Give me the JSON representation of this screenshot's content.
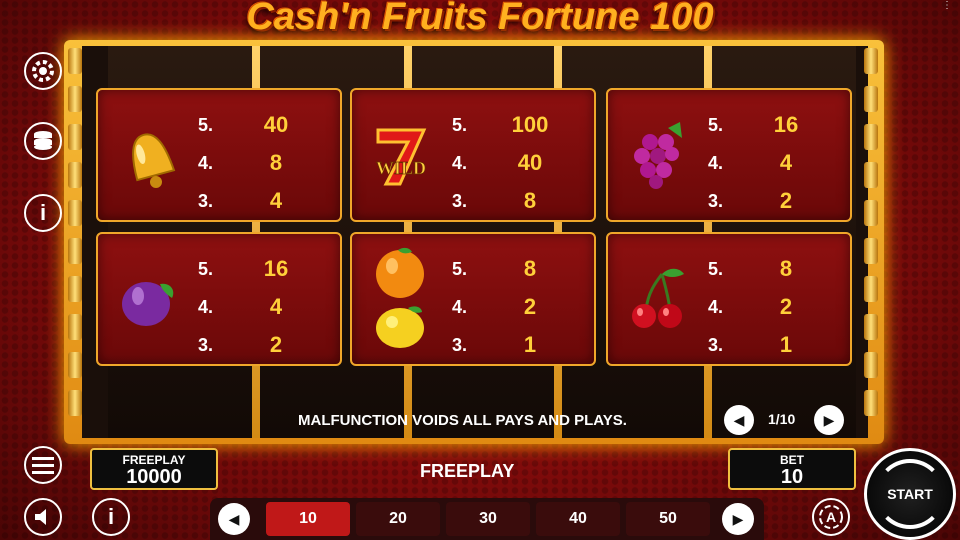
{
  "game": {
    "title": "Cash'n Fruits Fortune 100",
    "corner_mark": "⋮"
  },
  "paytable": [
    {
      "symbol": "bell",
      "rows": [
        {
          "count": "5.",
          "pay": "40"
        },
        {
          "count": "4.",
          "pay": "8"
        },
        {
          "count": "3.",
          "pay": "4"
        }
      ]
    },
    {
      "symbol": "wild-seven",
      "wild_text": "WILD",
      "rows": [
        {
          "count": "5.",
          "pay": "100"
        },
        {
          "count": "4.",
          "pay": "40"
        },
        {
          "count": "3.",
          "pay": "8"
        }
      ]
    },
    {
      "symbol": "grapes",
      "rows": [
        {
          "count": "5.",
          "pay": "16"
        },
        {
          "count": "4.",
          "pay": "4"
        },
        {
          "count": "3.",
          "pay": "2"
        }
      ]
    },
    {
      "symbol": "plum",
      "rows": [
        {
          "count": "5.",
          "pay": "16"
        },
        {
          "count": "4.",
          "pay": "4"
        },
        {
          "count": "3.",
          "pay": "2"
        }
      ]
    },
    {
      "symbol": "orange-lemon",
      "rows": [
        {
          "count": "5.",
          "pay": "8"
        },
        {
          "count": "4.",
          "pay": "2"
        },
        {
          "count": "3.",
          "pay": "1"
        }
      ]
    },
    {
      "symbol": "cherries",
      "rows": [
        {
          "count": "5.",
          "pay": "8"
        },
        {
          "count": "4.",
          "pay": "2"
        },
        {
          "count": "3.",
          "pay": "1"
        }
      ]
    }
  ],
  "notice": "MALFUNCTION VOIDS ALL PAYS AND PLAYS.",
  "pager": {
    "text": "1/10"
  },
  "freeplay_box": {
    "label": "FREEPLAY",
    "value": "10000"
  },
  "mode_label": "FREEPLAY",
  "bet_box": {
    "label": "BET",
    "value": "10"
  },
  "bet_options": [
    {
      "label": "10",
      "selected": true
    },
    {
      "label": "20",
      "selected": false
    },
    {
      "label": "30",
      "selected": false
    },
    {
      "label": "40",
      "selected": false
    },
    {
      "label": "50",
      "selected": false
    }
  ],
  "start_label": "START",
  "left_icons": [
    "gear-icon",
    "coins-icon",
    "info-icon"
  ],
  "bottom_icons": [
    "menu-icon",
    "sound-icon",
    "info-icon",
    "autoplay-icon"
  ],
  "colors": {
    "accent": "#ffd03a",
    "frame": "#f0a72a",
    "selected_bet": "#c01818"
  }
}
